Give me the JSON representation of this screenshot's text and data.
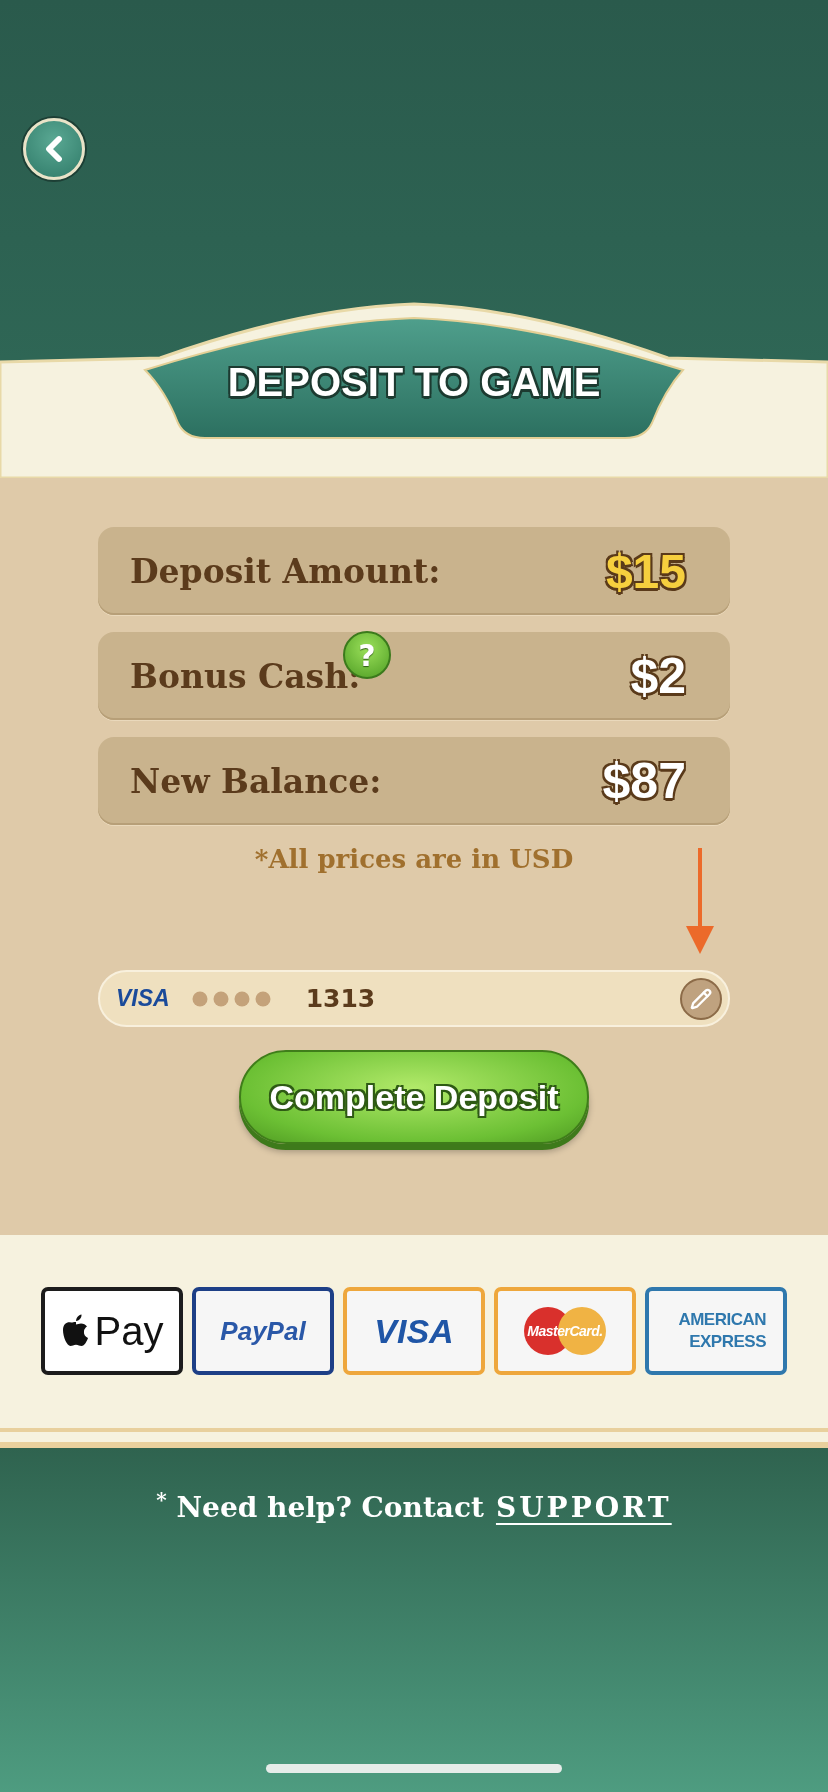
{
  "title": "DEPOSIT TO GAME",
  "summary_rows": [
    {
      "label": "Deposit Amount:",
      "value": "$15",
      "highlight": true
    },
    {
      "label": "Bonus Cash:",
      "value": "$2",
      "highlight": false,
      "help_icon": "?"
    },
    {
      "label": "New Balance:",
      "value": "$87",
      "highlight": false
    }
  ],
  "note": "*All prices are in USD",
  "card": {
    "brand": "VISA",
    "last_digits": "1313"
  },
  "submit_button": "Complete Deposit",
  "payment_methods": [
    {
      "kind": "applepay",
      "text": "Pay",
      "color": "#1c1c1c"
    },
    {
      "kind": "paypal",
      "text": "PayPal",
      "color": "#1d3f86"
    },
    {
      "kind": "visa",
      "text": "VISA",
      "color": "#eea73c"
    },
    {
      "kind": "mastercard",
      "text": "MasterCard.",
      "color": "#eea73c"
    },
    {
      "kind": "amex",
      "text": "AMERICAN EXPRESS",
      "color": "#2f78ad"
    }
  ],
  "help": {
    "text": "$^{*}$ Need help? Contact",
    "link": "SUPPORT"
  }
}
